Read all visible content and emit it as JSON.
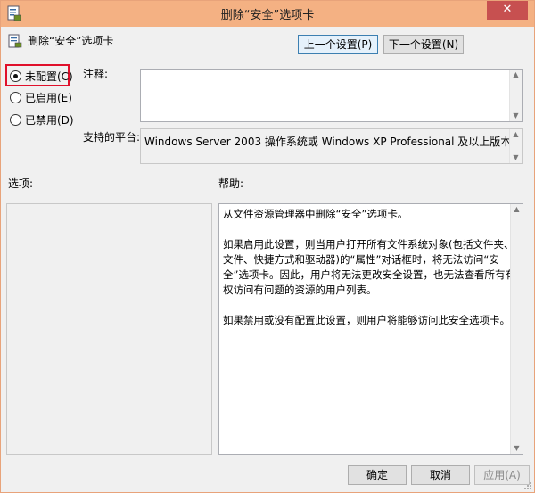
{
  "window": {
    "title": "删除“安全”选项卡",
    "close_glyph": "✕"
  },
  "header": {
    "setting_name": "删除“安全”选项卡"
  },
  "nav": {
    "prev_label": "上一个设置(P)",
    "next_label": "下一个设置(N)"
  },
  "state": {
    "options": [
      {
        "label": "未配置(C)",
        "selected": true
      },
      {
        "label": "已启用(E)",
        "selected": false
      },
      {
        "label": "已禁用(D)",
        "selected": false
      }
    ]
  },
  "comment": {
    "label": "注释:",
    "value": ""
  },
  "platform": {
    "label": "支持的平台:",
    "value": "Windows Server 2003 操作系统或 Windows XP Professional 及以上版本"
  },
  "options_panel": {
    "label": "选项:"
  },
  "help_panel": {
    "label": "帮助:",
    "paragraphs": [
      "从文件资源管理器中删除“安全”选项卡。",
      "如果启用此设置，则当用户打开所有文件系统对象(包括文件夹、文件、快捷方式和驱动器)的“属性”对话框时，将无法访问“安全”选项卡。因此，用户将无法更改安全设置，也无法查看所有有权访问有问题的资源的用户列表。",
      "如果禁用或没有配置此设置，则用户将能够访问此安全选项卡。"
    ]
  },
  "footer": {
    "ok_label": "确定",
    "cancel_label": "取消",
    "apply_label": "应用(A)"
  },
  "icons": {
    "app": "policy-setting-icon",
    "scroll_up": "scroll-up-icon",
    "scroll_down": "scroll-down-icon"
  },
  "colors": {
    "titlebar": "#f4b183",
    "close": "#c75050",
    "highlight": "#e0102b"
  }
}
